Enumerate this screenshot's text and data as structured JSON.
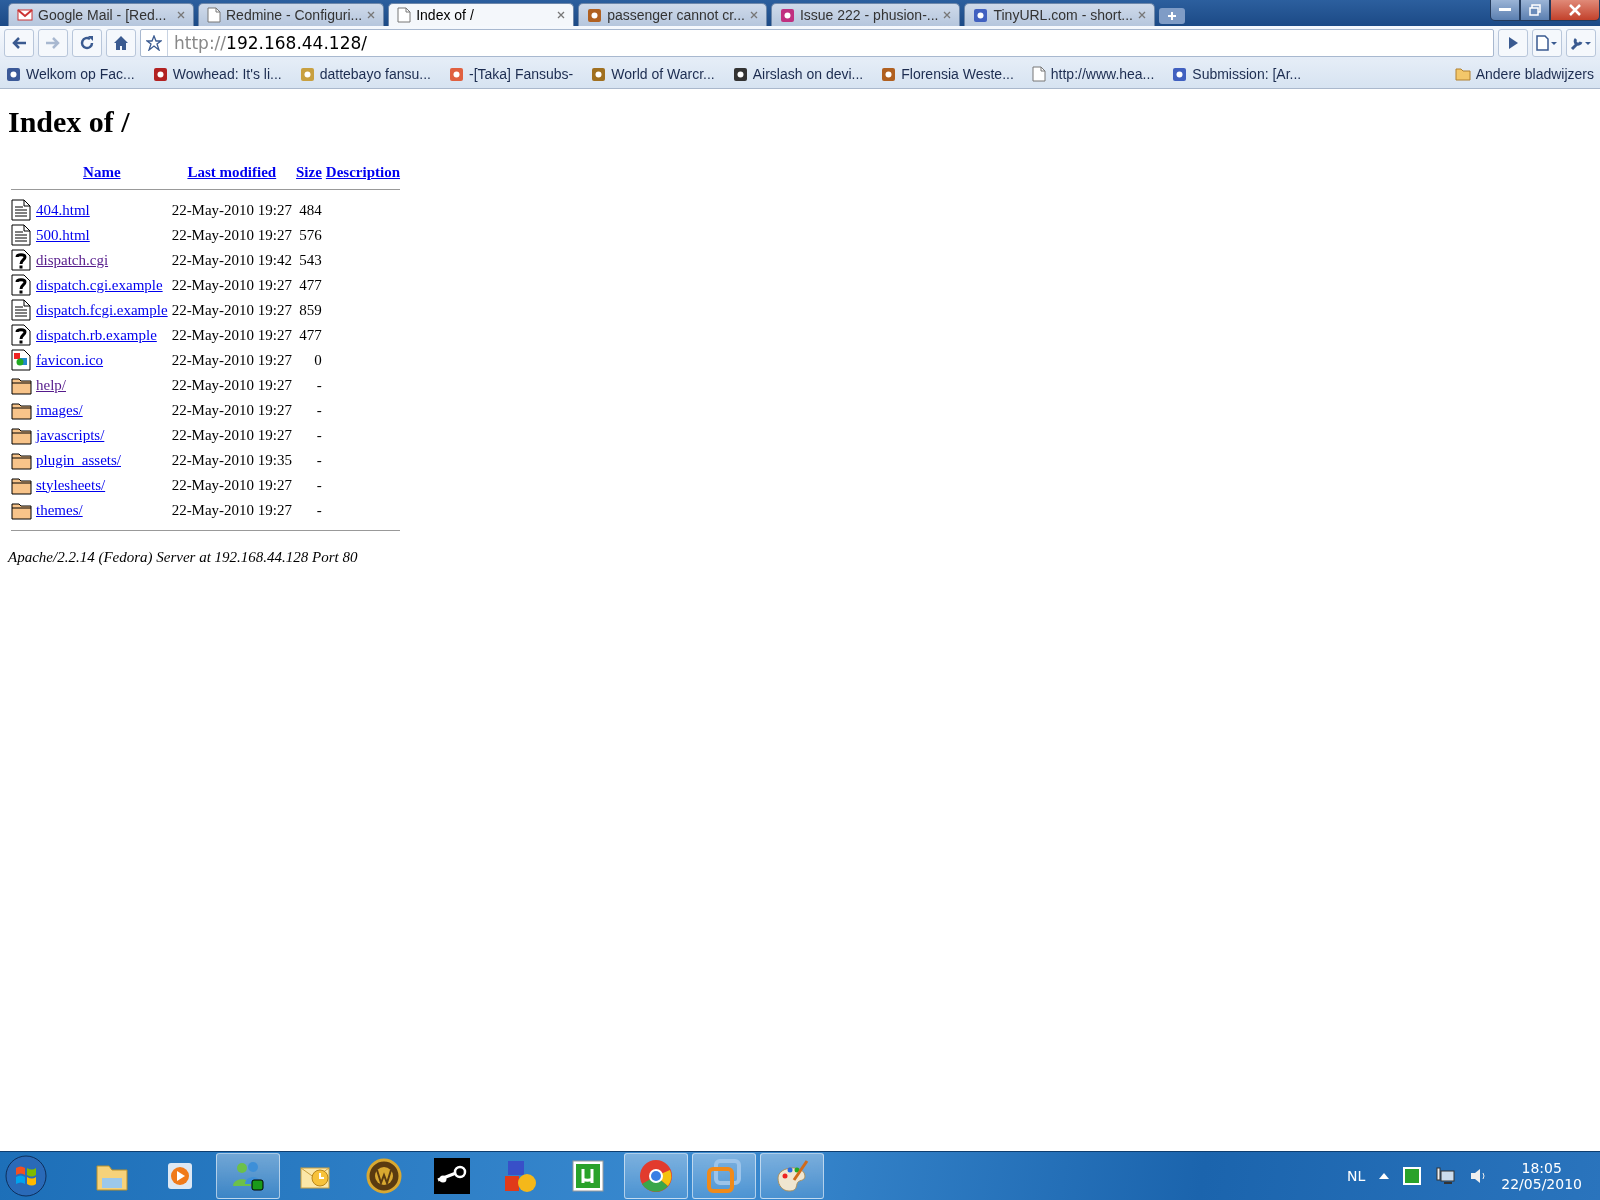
{
  "tabs": [
    {
      "title": "Google Mail - [Red...",
      "kind": "mail",
      "selected": false
    },
    {
      "title": "Redmine - Configuri...",
      "kind": "page",
      "selected": false
    },
    {
      "title": "Index of /",
      "kind": "page",
      "selected": true
    },
    {
      "title": "passenger cannot cr...",
      "kind": "site",
      "selected": false
    },
    {
      "title": "Issue 222 - phusion-...",
      "kind": "site",
      "selected": false
    },
    {
      "title": "TinyURL.com - short...",
      "kind": "site",
      "selected": false
    }
  ],
  "address": {
    "scheme": "http://",
    "rest": "192.168.44.128/"
  },
  "bookmarks": [
    {
      "label": "Welkom op Fac...",
      "kind": "site"
    },
    {
      "label": "Wowhead: It's li...",
      "kind": "site"
    },
    {
      "label": "dattebayo fansu...",
      "kind": "site"
    },
    {
      "label": "-[Taka] Fansubs-",
      "kind": "site"
    },
    {
      "label": "World of Warcr...",
      "kind": "site"
    },
    {
      "label": "Airslash on devi...",
      "kind": "site"
    },
    {
      "label": "Florensia Weste...",
      "kind": "site"
    },
    {
      "label": "http://www.hea...",
      "kind": "page"
    },
    {
      "label": "Submission: [Ar...",
      "kind": "site"
    }
  ],
  "other_bookmarks": {
    "label": "Andere bladwijzers"
  },
  "page": {
    "heading": "Index of /",
    "columns": [
      "Name",
      "Last modified",
      "Size",
      "Description"
    ],
    "rows": [
      {
        "kind": "text",
        "name": "404.html",
        "visited": false,
        "modified": "22-May-2010 19:27",
        "size": "484"
      },
      {
        "kind": "text",
        "name": "500.html",
        "visited": false,
        "modified": "22-May-2010 19:27",
        "size": "576"
      },
      {
        "kind": "unknown",
        "name": "dispatch.cgi",
        "visited": true,
        "modified": "22-May-2010 19:42",
        "size": "543"
      },
      {
        "kind": "unknown",
        "name": "dispatch.cgi.example",
        "visited": false,
        "modified": "22-May-2010 19:27",
        "size": "477"
      },
      {
        "kind": "text",
        "name": "dispatch.fcgi.example",
        "visited": false,
        "modified": "22-May-2010 19:27",
        "size": "859"
      },
      {
        "kind": "unknown",
        "name": "dispatch.rb.example",
        "visited": false,
        "modified": "22-May-2010 19:27",
        "size": "477"
      },
      {
        "kind": "image",
        "name": "favicon.ico",
        "visited": false,
        "modified": "22-May-2010 19:27",
        "size": "0"
      },
      {
        "kind": "folder",
        "name": "help/",
        "visited": true,
        "modified": "22-May-2010 19:27",
        "size": "-"
      },
      {
        "kind": "folder",
        "name": "images/",
        "visited": false,
        "modified": "22-May-2010 19:27",
        "size": "-"
      },
      {
        "kind": "folder",
        "name": "javascripts/",
        "visited": false,
        "modified": "22-May-2010 19:27",
        "size": "-"
      },
      {
        "kind": "folder",
        "name": "plugin_assets/",
        "visited": false,
        "modified": "22-May-2010 19:35",
        "size": "-"
      },
      {
        "kind": "folder",
        "name": "stylesheets/",
        "visited": false,
        "modified": "22-May-2010 19:27",
        "size": "-"
      },
      {
        "kind": "folder",
        "name": "themes/",
        "visited": false,
        "modified": "22-May-2010 19:27",
        "size": "-"
      }
    ],
    "footer": "Apache/2.2.14 (Fedora) Server at 192.168.44.128 Port 80"
  },
  "taskbar": {
    "items": [
      {
        "kind": "explorer",
        "running": false
      },
      {
        "kind": "player",
        "running": false
      },
      {
        "kind": "messenger",
        "running": true
      },
      {
        "kind": "mail",
        "running": false
      },
      {
        "kind": "emblem",
        "running": false
      },
      {
        "kind": "steam",
        "running": false
      },
      {
        "kind": "blocks",
        "running": false
      },
      {
        "kind": "torrent",
        "running": false
      },
      {
        "kind": "browser",
        "running": true
      },
      {
        "kind": "vm",
        "running": true
      },
      {
        "kind": "paint",
        "running": true
      }
    ],
    "language": "NL",
    "time": "18:05",
    "date": "22/05/2010"
  }
}
